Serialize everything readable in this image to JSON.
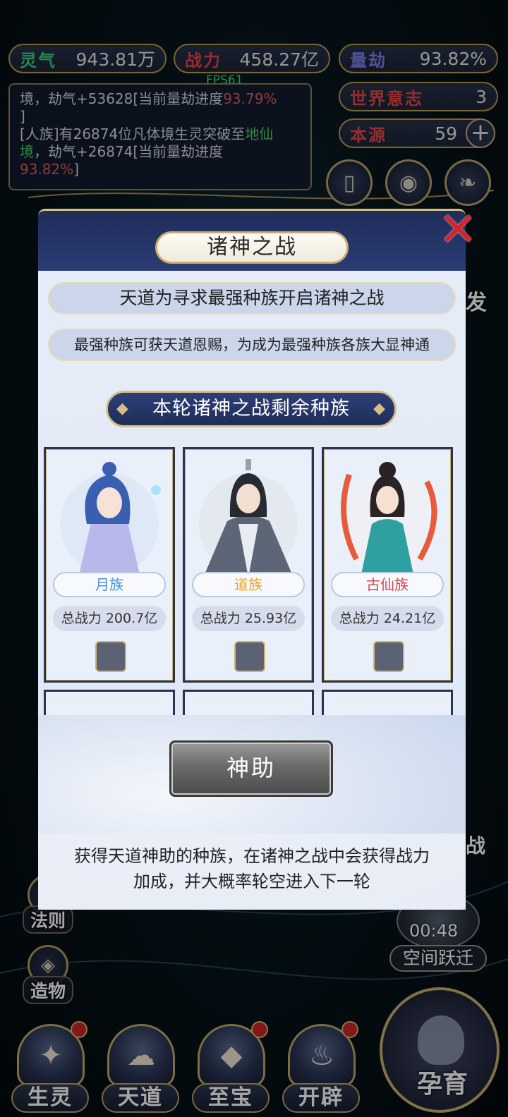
{
  "resources": {
    "lingqi": {
      "label": "灵气",
      "value": "943.81万",
      "color": "#3dd07a"
    },
    "zhanli": {
      "label": "战力",
      "value": "458.27亿",
      "color": "#e04848"
    },
    "liangjie": {
      "label": "量劫",
      "value": "93.82%",
      "color": "#7c7ee8"
    },
    "shijie": {
      "label": "世界意志",
      "value": "3",
      "color": "#e04848"
    },
    "benyuan": {
      "label": "本源",
      "value": "59",
      "color": "#e04848"
    }
  },
  "fps": "FPS61",
  "log": {
    "line1_a": "境，劫气+53628[当前量劫进度",
    "line1_pct": "93.79%",
    "line1_end": "]",
    "line2_a": "[人族]有26874位凡体境生灵突破至",
    "line2_green": "地仙境",
    "line2_b": "，劫气+26874[当前量劫进度",
    "line2_pct": "93.82%",
    "line2_end": "]"
  },
  "side_menu": [
    "法则",
    "造物"
  ],
  "side_partial": [
    "发",
    "战"
  ],
  "timer": {
    "time": "00:48",
    "label": "空间跃迁"
  },
  "bottom_nav": [
    "生灵",
    "天道",
    "至宝",
    "开辟"
  ],
  "big_button": "孕育",
  "modal": {
    "title": "诸神之战",
    "info1": "天道为寻求最强种族开启诸神之战",
    "info2": "最强种族可获天道恩赐，为成为最强种族各族大显神通",
    "section": "本轮诸神之战剩余种族",
    "cards": [
      {
        "name": "月族",
        "power": "总战力 200.7亿",
        "color": "#4a90d9"
      },
      {
        "name": "道族",
        "power": "总战力 25.93亿",
        "color": "#e8a51e"
      },
      {
        "name": "古仙族",
        "power": "总战力 24.21亿",
        "color": "#d8434a"
      }
    ],
    "button": "神助",
    "desc_line1": "获得天道神助的种族，在诸神之战中会获得战力",
    "desc_line2": "加成，并大概率轮空进入下一轮"
  }
}
